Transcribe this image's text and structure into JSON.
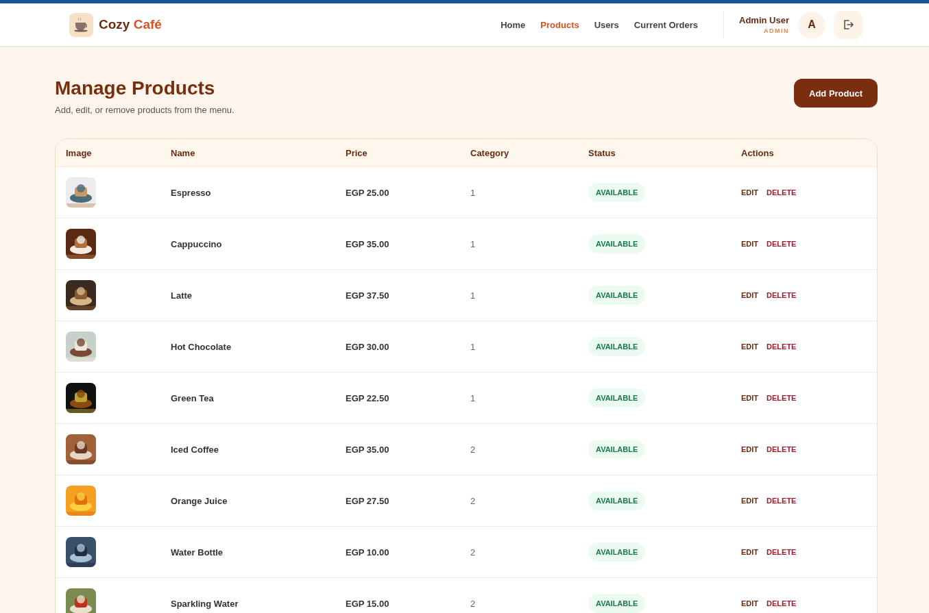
{
  "header": {
    "brand": {
      "name": "Cozy",
      "accent": "Café"
    },
    "nav": [
      {
        "label": "Home",
        "selected": false
      },
      {
        "label": "Products",
        "selected": true
      },
      {
        "label": "Users",
        "selected": false
      },
      {
        "label": "Current Orders",
        "selected": false
      }
    ],
    "user": {
      "name": "Admin User",
      "role": "ADMIN",
      "initial": "A"
    }
  },
  "page": {
    "title": "Manage Products",
    "subtitle": "Add, edit, or remove products from the menu.",
    "add_button": "Add Product"
  },
  "table": {
    "columns": [
      "Image",
      "Name",
      "Price",
      "Category",
      "Status",
      "Actions"
    ],
    "rows": [
      {
        "name": "Espresso",
        "price": "EGP 25.00",
        "category": "1",
        "status": "AVAILABLE",
        "available": true,
        "edit": "EDIT",
        "delete": "DELETE"
      },
      {
        "name": "Cappuccino",
        "price": "EGP 35.00",
        "category": "1",
        "status": "AVAILABLE",
        "available": true,
        "edit": "EDIT",
        "delete": "DELETE"
      },
      {
        "name": "Latte",
        "price": "EGP 37.50",
        "category": "1",
        "status": "AVAILABLE",
        "available": true,
        "edit": "EDIT",
        "delete": "DELETE"
      },
      {
        "name": "Hot Chocolate",
        "price": "EGP 30.00",
        "category": "1",
        "status": "AVAILABLE",
        "available": true,
        "edit": "EDIT",
        "delete": "DELETE"
      },
      {
        "name": "Green Tea",
        "price": "EGP 22.50",
        "category": "1",
        "status": "AVAILABLE",
        "available": true,
        "edit": "EDIT",
        "delete": "DELETE"
      },
      {
        "name": "Iced Coffee",
        "price": "EGP 35.00",
        "category": "2",
        "status": "AVAILABLE",
        "available": true,
        "edit": "EDIT",
        "delete": "DELETE"
      },
      {
        "name": "Orange Juice",
        "price": "EGP 27.50",
        "category": "2",
        "status": "AVAILABLE",
        "available": true,
        "edit": "EDIT",
        "delete": "DELETE"
      },
      {
        "name": "Water Bottle",
        "price": "EGP 10.00",
        "category": "2",
        "status": "AVAILABLE",
        "available": true,
        "edit": "EDIT",
        "delete": "DELETE"
      },
      {
        "name": "Sparkling Water",
        "price": "EGP 15.00",
        "category": "2",
        "status": "AVAILABLE",
        "available": true,
        "edit": "EDIT",
        "delete": "DELETE"
      }
    ]
  }
}
